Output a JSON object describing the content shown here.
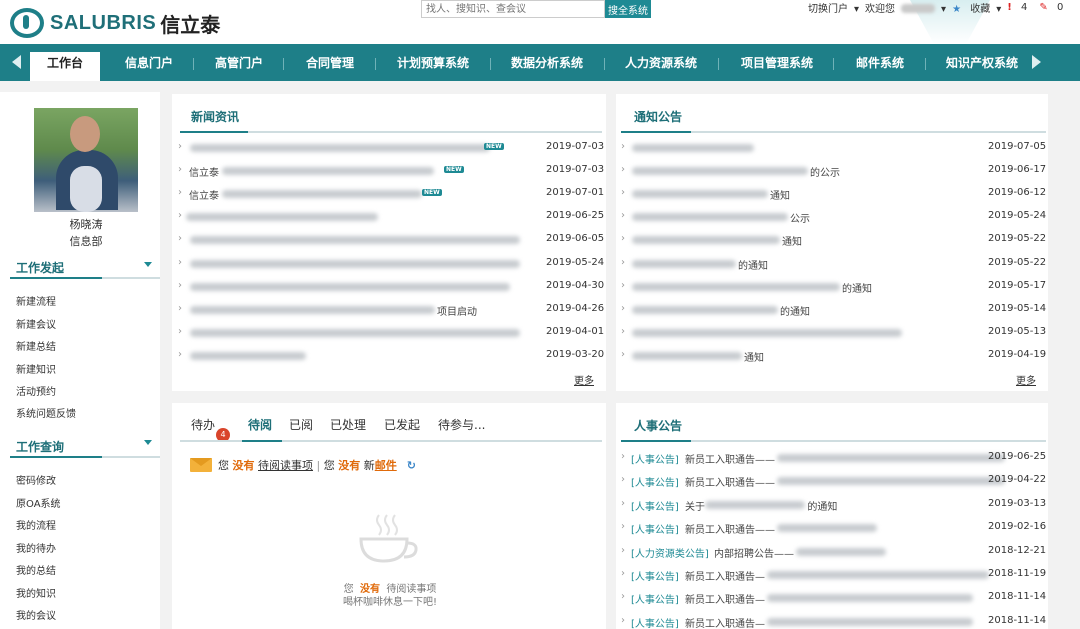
{
  "brand": {
    "name": "SALUBRIS",
    "cn": "信立泰"
  },
  "search": {
    "placeholder": "找人、搜知识、查会议",
    "button": "搜全系统"
  },
  "topbar": {
    "switch_portal": "切换门户",
    "welcome": "欢迎您",
    "favorites": "收藏",
    "alert_count": "4",
    "edit_count": "0"
  },
  "nav": [
    "工作台",
    "信息门户",
    "高管门户",
    "合同管理",
    "计划预算系统",
    "数据分析系统",
    "人力资源系统",
    "项目管理系统",
    "邮件系统",
    "知识产权系统"
  ],
  "user": {
    "name": "杨晓涛",
    "dept": "信息部"
  },
  "work_start": {
    "title": "工作发起",
    "items": [
      "新建流程",
      "新建会议",
      "新建总结",
      "新建知识",
      "活动预约",
      "系统问题反馈"
    ]
  },
  "work_query": {
    "title": "工作查询",
    "items": [
      "密码修改",
      "原OA系统",
      "我的流程",
      "我的待办",
      "我的总结",
      "我的知识",
      "我的会议"
    ]
  },
  "news": {
    "title": "新闻资讯",
    "more": "更多",
    "rows": [
      {
        "prefix": "",
        "suffix": "",
        "date": "2019-07-03",
        "new": "NEW"
      },
      {
        "prefix": "信立泰",
        "suffix": "",
        "date": "2019-07-03",
        "new": "NEW"
      },
      {
        "prefix": "信立泰",
        "suffix": "",
        "date": "2019-07-01",
        "new": "NEW"
      },
      {
        "prefix": "",
        "suffix": "",
        "date": "2019-06-25",
        "new": ""
      },
      {
        "prefix": "",
        "suffix": "",
        "date": "2019-06-05",
        "new": ""
      },
      {
        "prefix": "",
        "suffix": "",
        "date": "2019-05-24",
        "new": ""
      },
      {
        "prefix": "",
        "suffix": "",
        "date": "2019-04-30",
        "new": ""
      },
      {
        "prefix": "",
        "suffix": "项目启动",
        "date": "2019-04-26",
        "new": ""
      },
      {
        "prefix": "",
        "suffix": "",
        "date": "2019-04-01",
        "new": ""
      },
      {
        "prefix": "",
        "suffix": "",
        "date": "2019-03-20",
        "new": ""
      }
    ]
  },
  "notice": {
    "title": "通知公告",
    "more": "更多",
    "rows": [
      {
        "suffix": "",
        "date": "2019-07-05"
      },
      {
        "suffix": "的公示",
        "date": "2019-06-17"
      },
      {
        "suffix": "通知",
        "date": "2019-06-12"
      },
      {
        "suffix": "公示",
        "date": "2019-05-24"
      },
      {
        "suffix": "通知",
        "date": "2019-05-22"
      },
      {
        "suffix": "的通知",
        "date": "2019-05-22"
      },
      {
        "suffix": "的通知",
        "date": "2019-05-17"
      },
      {
        "suffix": "的通知",
        "date": "2019-05-14"
      },
      {
        "suffix": "",
        "date": "2019-05-13"
      },
      {
        "suffix": "通知",
        "date": "2019-04-19"
      }
    ]
  },
  "tasks": {
    "tabs": [
      "待办",
      "待阅",
      "已阅",
      "已处理",
      "已发起",
      "待参与..."
    ],
    "todo_badge": "4",
    "line": {
      "you": "您",
      "none": "没有",
      "pending_read": "待阅读事项",
      "sep": "|",
      "you2": "您",
      "none2": "没有",
      "new": "新",
      "mail": "邮件"
    },
    "empty_line1": {
      "you": "您",
      "none": "没有",
      "rest": "待阅读事项"
    },
    "empty_line2": "喝杯咖啡休息一下吧!"
  },
  "hr": {
    "title": "人事公告",
    "rows": [
      {
        "tag": "[人事公告]",
        "text": "新员工入职通告——",
        "date": "2019-06-25"
      },
      {
        "tag": "[人事公告]",
        "text": "新员工入职通告——",
        "date": "2019-04-22"
      },
      {
        "tag": "[人事公告]",
        "text": "关于",
        "suffix": "的通知",
        "date": "2019-03-13"
      },
      {
        "tag": "[人事公告]",
        "text": "新员工入职通告——",
        "date": "2019-02-16"
      },
      {
        "tag": "[人力资源类公告]",
        "text": "内部招聘公告——",
        "date": "2018-12-21"
      },
      {
        "tag": "[人事公告]",
        "text": "新员工入职通告—",
        "date": "2018-11-19"
      },
      {
        "tag": "[人事公告]",
        "text": "新员工入职通告—",
        "date": "2018-11-14"
      },
      {
        "tag": "[人事公告]",
        "text": "新员工入职通告—",
        "date": "2018-11-14"
      }
    ]
  },
  "colors": {
    "teal": "#1e7f88",
    "accent": "#1e8a94",
    "orange": "#e06a0a",
    "badge": "#d9452b"
  }
}
